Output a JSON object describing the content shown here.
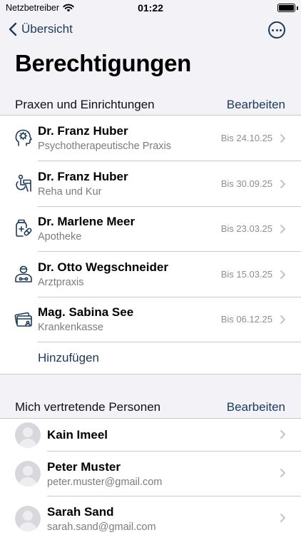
{
  "status_bar": {
    "carrier": "Netzbetreiber",
    "time": "01:22"
  },
  "nav": {
    "back_label": "Übersicht"
  },
  "page_title": "Berechtigungen",
  "colors": {
    "accent": "#1b3a5c",
    "secondary_text": "#7c7c80",
    "background": "#f2f2f7"
  },
  "practices": {
    "title": "Praxen und Einrichtungen",
    "edit_label": "Bearbeiten",
    "items": [
      {
        "name": "Dr. Franz Huber",
        "type": "Psychotherapeutische Praxis",
        "valid_until": "Bis 24.10.25",
        "icon": "head-brain-icon"
      },
      {
        "name": "Dr. Franz Huber",
        "type": "Reha und Kur",
        "valid_until": "Bis 30.09.25",
        "icon": "rehab-icon"
      },
      {
        "name": "Dr. Marlene Meer",
        "type": "Apotheke",
        "valid_until": "Bis 23.03.25",
        "icon": "pharmacy-icon"
      },
      {
        "name": "Dr. Otto Wegschneider",
        "type": "Arztpraxis",
        "valid_until": "Bis 15.03.25",
        "icon": "doctor-icon"
      },
      {
        "name": "Mag. Sabina See",
        "type": "Krankenkasse",
        "valid_until": "Bis 06.12.25",
        "icon": "insurance-card-icon"
      }
    ],
    "add_label": "Hinzufügen"
  },
  "representatives": {
    "title": "Mich vertretende Personen",
    "edit_label": "Bearbeiten",
    "items": [
      {
        "name": "Kain Imeel",
        "email": ""
      },
      {
        "name": "Peter Muster",
        "email": "peter.muster@gmail.com"
      },
      {
        "name": "Sarah Sand",
        "email": "sarah.sand@gmail.com"
      }
    ]
  }
}
